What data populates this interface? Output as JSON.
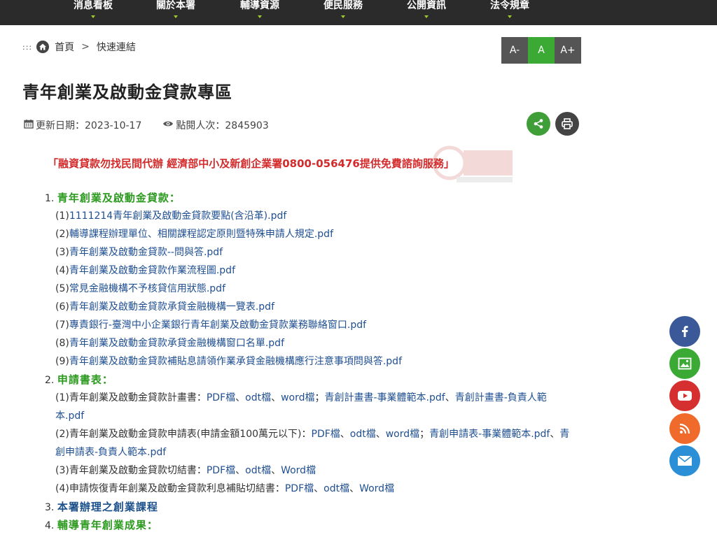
{
  "nav": {
    "items": [
      "消息看板",
      "關於本署",
      "輔導資源",
      "便民服務",
      "公開資訊",
      "法令規章"
    ]
  },
  "breadcrumb": {
    "dots": ":::",
    "home": "首頁",
    "sep": ">",
    "current": "快速連結"
  },
  "fontsize": {
    "small": "A-",
    "normal": "A",
    "large": "A+"
  },
  "page": {
    "title": "青年創業及啟動金貸款專區",
    "updated": "更新日期：2023-10-17",
    "views": "點閱人次：2845903"
  },
  "notice": "「融資貸款勿找民間代辦 經濟部中小及新創企業署0800-056476提供免費諮詢服務」",
  "sections": [
    {
      "num": "1.",
      "title": "青年創業及啟動金貸款：",
      "items": [
        {
          "pfx": "(1)",
          "text": "1111214青年創業及啟動金貸款要點(含沿革).pdf"
        },
        {
          "pfx": "(2)",
          "text": "輔導課程辦理單位、相關課程認定原則暨特殊申請人規定.pdf"
        },
        {
          "pfx": "(3)",
          "text": "青年創業及啟動金貸款--問與答.pdf"
        },
        {
          "pfx": "(4)",
          "text": "青年創業及啟動金貸款作業流程圖.pdf"
        },
        {
          "pfx": "(5)",
          "text": "常見金融機構不予核貸信用狀態.pdf"
        },
        {
          "pfx": "(6)",
          "text": "青年創業及啟動金貸款承貸金融機構一覽表.pdf"
        },
        {
          "pfx": "(7)",
          "text": "專責銀行-臺灣中小企業銀行青年創業及啟動金貸款業務聯絡窗口.pdf"
        },
        {
          "pfx": "(8)",
          "text": "青年創業及啟動金貸款承貸金融機構窗口名單.pdf"
        },
        {
          "pfx": "(9)",
          "text": "青年創業及啟動金貸款補貼息請領作業承貸金融機構應行注意事項問與答.pdf"
        }
      ]
    },
    {
      "num": "2.",
      "title": "申請書表：",
      "items": [
        {
          "pfx": "(1)",
          "plain": "青年創業及啟動金貸款計畫書：",
          "links": [
            "PDF檔",
            "odt檔",
            "word檔"
          ],
          "sep1": "、",
          "semi": "；",
          "extra": [
            "青創計畫書-事業體範本.pdf",
            "青創計畫書-負責人範本.pdf"
          ]
        },
        {
          "pfx": "(2)",
          "plain": "青年創業及啟動金貸款申請表(申請金額100萬元以下)：",
          "links": [
            "PDF檔",
            "odt檔",
            "word檔"
          ],
          "sep1": "、",
          "semi": "；",
          "extra": [
            "青創申請表-事業體範本.pdf",
            "青創申請表-負責人範本.pdf"
          ]
        },
        {
          "pfx": "(3)",
          "plain": "青年創業及啟動金貸款切結書：",
          "links": [
            "PDF檔",
            "odt檔",
            "Word檔"
          ],
          "sep1": "、"
        },
        {
          "pfx": "(4)",
          "plain": "申請恢復青年創業及啟動金貸款利息補貼切結書：",
          "links": [
            "PDF檔",
            "odt檔",
            "Word檔"
          ],
          "sep1": "、"
        }
      ]
    },
    {
      "num": "3.",
      "title": "本署辦理之創業課程"
    },
    {
      "num": "4.",
      "title": "輔導青年創業成果："
    }
  ],
  "colors": {
    "nav_bg": "#2b2b2b",
    "accent_green": "#3aaa35",
    "link_blue": "#1f4f91",
    "notice_red": "#d32b2b",
    "section_green": "#2c9a1f",
    "facebook": "#3b5998",
    "photo": "#3aaa35",
    "youtube": "#d62f2f",
    "rss": "#f06a2b",
    "mail": "#2a8fd6"
  },
  "social": [
    "facebook-icon",
    "photo-icon",
    "youtube-icon",
    "rss-icon",
    "mail-icon"
  ]
}
